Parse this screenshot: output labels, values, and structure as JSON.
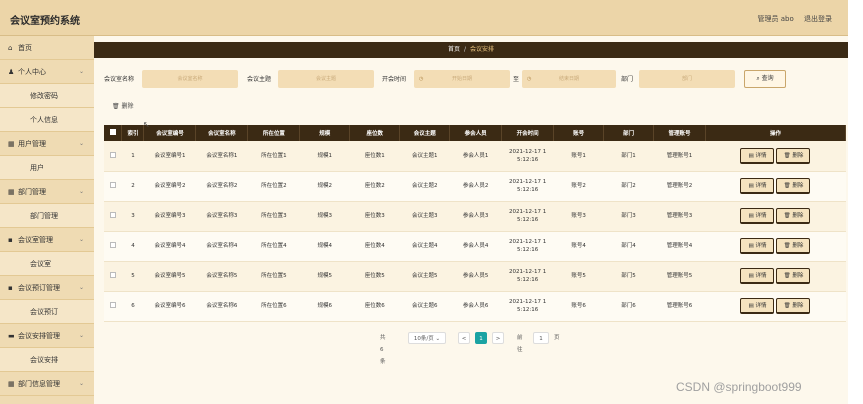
{
  "app_title": "会议室预约系统",
  "user": {
    "role": "管理员 abo",
    "logout": "退出登录"
  },
  "sidebar": [
    {
      "label": "首页",
      "icon": "home-icon",
      "glyph": "⌂",
      "sub": false
    },
    {
      "label": "个人中心",
      "icon": "user-icon",
      "glyph": "♟",
      "sub": false,
      "chevron": true
    },
    {
      "label": "修改密码",
      "sub": true
    },
    {
      "label": "个人信息",
      "sub": true
    },
    {
      "label": "用户管理",
      "icon": "grid-icon",
      "glyph": "▦",
      "sub": false,
      "chevron": true
    },
    {
      "label": "用户",
      "sub": true
    },
    {
      "label": "部门管理",
      "icon": "grid-icon",
      "glyph": "▦",
      "sub": false,
      "chevron": true
    },
    {
      "label": "部门管理",
      "sub": true
    },
    {
      "label": "会议室管理",
      "icon": "lock-icon",
      "glyph": "▪",
      "sub": false,
      "chevron": true
    },
    {
      "label": "会议室",
      "sub": true
    },
    {
      "label": "会议预订管理",
      "icon": "lock-icon",
      "glyph": "▪",
      "sub": false,
      "chevron": true
    },
    {
      "label": "会议预订",
      "sub": true
    },
    {
      "label": "会议安排管理",
      "icon": "folder-icon",
      "glyph": "▬",
      "sub": false,
      "chevron": true
    },
    {
      "label": "会议安排",
      "sub": true
    },
    {
      "label": "部门信息管理",
      "icon": "grid-icon",
      "glyph": "▦",
      "sub": false,
      "chevron": true
    }
  ],
  "breadcrumb": {
    "home": "首页",
    "sep": "/",
    "current": "会议安排"
  },
  "search": {
    "room_name_label": "会议室名称",
    "room_name_placeholder": "会议室名称",
    "topic_label": "会议主题",
    "topic_placeholder": "会议主题",
    "start_label": "开会时间",
    "start_placeholder": "开始日期",
    "to_label": "至",
    "end_placeholder": "结束日期",
    "dept_label": "部门",
    "dept_placeholder": "部门",
    "query_button": "查询"
  },
  "delete_label": "删除",
  "table": {
    "headers": [
      "索引",
      "会议室编号",
      "会议室名称",
      "所在位置",
      "规模",
      "座位数",
      "会议主题",
      "参会人员",
      "开会时间",
      "账号",
      "部门",
      "管理账号",
      "操作"
    ],
    "rows": [
      [
        "1",
        "会议室编号1",
        "会议室名称1",
        "所在位置1",
        "规模1",
        "座位数1",
        "会议主题1",
        "参会人员1",
        "2021-12-17 1\n5:12:16",
        "账号1",
        "部门1",
        "管理账号1"
      ],
      [
        "2",
        "会议室编号2",
        "会议室名称2",
        "所在位置2",
        "规模2",
        "座位数2",
        "会议主题2",
        "参会人员2",
        "2021-12-17 1\n5:12:16",
        "账号2",
        "部门2",
        "管理账号2"
      ],
      [
        "3",
        "会议室编号3",
        "会议室名称3",
        "所在位置3",
        "规模3",
        "座位数3",
        "会议主题3",
        "参会人员3",
        "2021-12-17 1\n5:12:16",
        "账号3",
        "部门3",
        "管理账号3"
      ],
      [
        "4",
        "会议室编号4",
        "会议室名称4",
        "所在位置4",
        "规模4",
        "座位数4",
        "会议主题4",
        "参会人员4",
        "2021-12-17 1\n5:12:16",
        "账号4",
        "部门4",
        "管理账号4"
      ],
      [
        "5",
        "会议室编号5",
        "会议室名称5",
        "所在位置5",
        "规模5",
        "座位数5",
        "会议主题5",
        "参会人员5",
        "2021-12-17 1\n5:12:16",
        "账号5",
        "部门5",
        "管理账号5"
      ],
      [
        "6",
        "会议室编号6",
        "会议室名称6",
        "所在位置6",
        "规模6",
        "座位数6",
        "会议主题6",
        "参会人员6",
        "2021-12-17 1\n5:12:16",
        "账号6",
        "部门6",
        "管理账号6"
      ]
    ],
    "detail_label": "详情",
    "delete_label": "删除"
  },
  "pager": {
    "total": "共 6 条",
    "page_size": "10条/页",
    "prev": "<",
    "page": "1",
    "next": ">",
    "goto_label": "前往",
    "goto_value": "1",
    "page_unit": "页"
  },
  "watermark": "CSDN @springboot999",
  "colors": {
    "sidebar": "#efdbb3",
    "header": "#3b2a14",
    "accent": "#1aa3a3"
  }
}
